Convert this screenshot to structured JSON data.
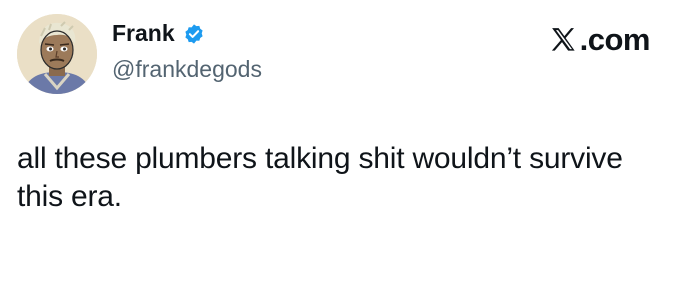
{
  "author": {
    "display_name": "Frank",
    "handle": "@frankdegods",
    "verified": true,
    "verified_color": "#1d9bf0",
    "avatar_icon": "cartoon-avatar-icon"
  },
  "brand": {
    "icon": "x-logo-icon",
    "domain_suffix": ".com"
  },
  "tweet": {
    "text": "all these plumbers talking shit wouldn’t survive this era."
  },
  "colors": {
    "text_primary": "#0f1419",
    "text_secondary": "#536471",
    "background": "#ffffff"
  }
}
